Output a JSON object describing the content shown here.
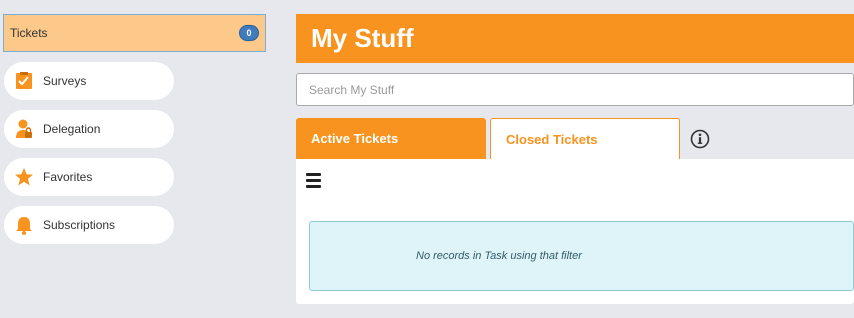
{
  "sidebar": {
    "tickets": {
      "label": "Tickets",
      "count": "0"
    },
    "items": [
      {
        "label": "Surveys",
        "icon": "clipboard-check-icon"
      },
      {
        "label": "Delegation",
        "icon": "person-lock-icon"
      },
      {
        "label": "Favorites",
        "icon": "star-icon"
      },
      {
        "label": "Subscriptions",
        "icon": "bell-icon"
      }
    ]
  },
  "main": {
    "title": "My Stuff",
    "search": {
      "placeholder": "Search My Stuff",
      "value": ""
    },
    "tabs": [
      {
        "label": "Active Tickets",
        "active": true
      },
      {
        "label": "Closed Tickets",
        "active": false
      }
    ],
    "info_icon": "info-circle-icon",
    "menu_icon": "hamburger-menu-icon",
    "empty_message": "No records in Task using that filter"
  },
  "colors": {
    "accent": "#f7931e",
    "selected_bg": "#fcc98b",
    "badge": "#3f7bbd",
    "empty_bg": "#dff4f8",
    "page_bg": "#e6e8ee"
  }
}
